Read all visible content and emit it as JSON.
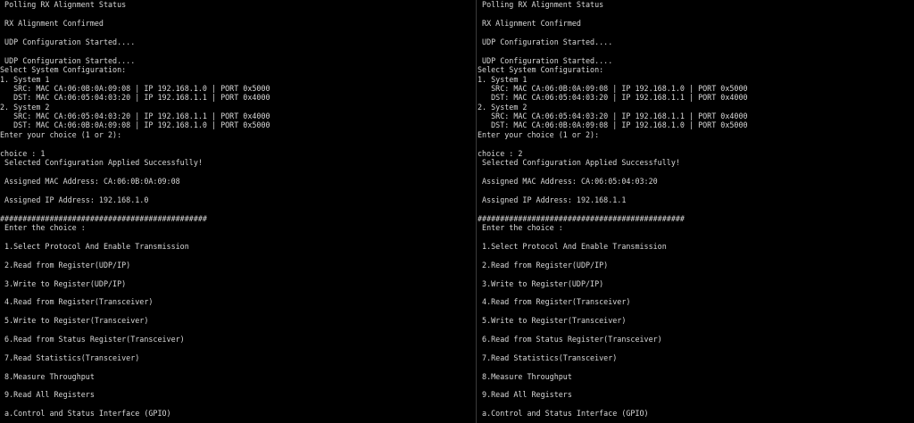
{
  "left_terminal": {
    "lines": [
      " Polling RX Alignment Status",
      " RX Alignment Confirmed",
      " UDP Configuration Started....",
      " UDP Configuration Started....",
      "Select System Configuration:",
      "1. System 1",
      "   SRC: MAC CA:06:0B:0A:09:08 | IP 192.168.1.0 | PORT 0x5000",
      "   DST: MAC CA:06:05:04:03:20 | IP 192.168.1.1 | PORT 0x4000",
      "2. System 2",
      "   SRC: MAC CA:06:05:04:03:20 | IP 192.168.1.1 | PORT 0x4000",
      "   DST: MAC CA:06:0B:0A:09:08 | IP 192.168.1.0 | PORT 0x5000",
      "Enter your choice (1 or 2):",
      "choice : 1",
      " Selected Configuration Applied Successfully!",
      " Assigned MAC Address: CA:06:0B:0A:09:08",
      " Assigned IP Address: 192.168.1.0",
      "##############################################",
      " Enter the choice :",
      " 1.Select Protocol And Enable Transmission",
      " 2.Read from Register(UDP/IP)",
      " 3.Write to Register(UDP/IP)",
      " 4.Read from Register(Transceiver)",
      " 5.Write to Register(Transceiver)",
      " 6.Read from Status Register(Transceiver)",
      " 7.Read Statistics(Transceiver)",
      " 8.Measure Throughput",
      " 9.Read All Registers",
      " a.Control and Status Interface (GPIO)"
    ]
  },
  "right_terminal": {
    "lines": [
      " Polling RX Alignment Status",
      " RX Alignment Confirmed",
      " UDP Configuration Started....",
      " UDP Configuration Started....",
      "Select System Configuration:",
      "1. System 1",
      "   SRC: MAC CA:06:0B:0A:09:08 | IP 192.168.1.0 | PORT 0x5000",
      "   DST: MAC CA:06:05:04:03:20 | IP 192.168.1.1 | PORT 0x4000",
      "2. System 2",
      "   SRC: MAC CA:06:05:04:03:20 | IP 192.168.1.1 | PORT 0x4000",
      "   DST: MAC CA:06:0B:0A:09:08 | IP 192.168.1.0 | PORT 0x5000",
      "Enter your choice (1 or 2):",
      "choice : 2",
      " Selected Configuration Applied Successfully!",
      " Assigned MAC Address: CA:06:05:04:03:20",
      " Assigned IP Address: 192.168.1.1",
      "##############################################",
      " Enter the choice :",
      " 1.Select Protocol And Enable Transmission",
      " 2.Read from Register(UDP/IP)",
      " 3.Write to Register(UDP/IP)",
      " 4.Read from Register(Transceiver)",
      " 5.Write to Register(Transceiver)",
      " 6.Read from Status Register(Transceiver)",
      " 7.Read Statistics(Transceiver)",
      " 8.Measure Throughput",
      " 9.Read All Registers",
      " a.Control and Status Interface (GPIO)"
    ]
  },
  "colors": {
    "background": "#000000",
    "text": "#d8d8d8"
  }
}
